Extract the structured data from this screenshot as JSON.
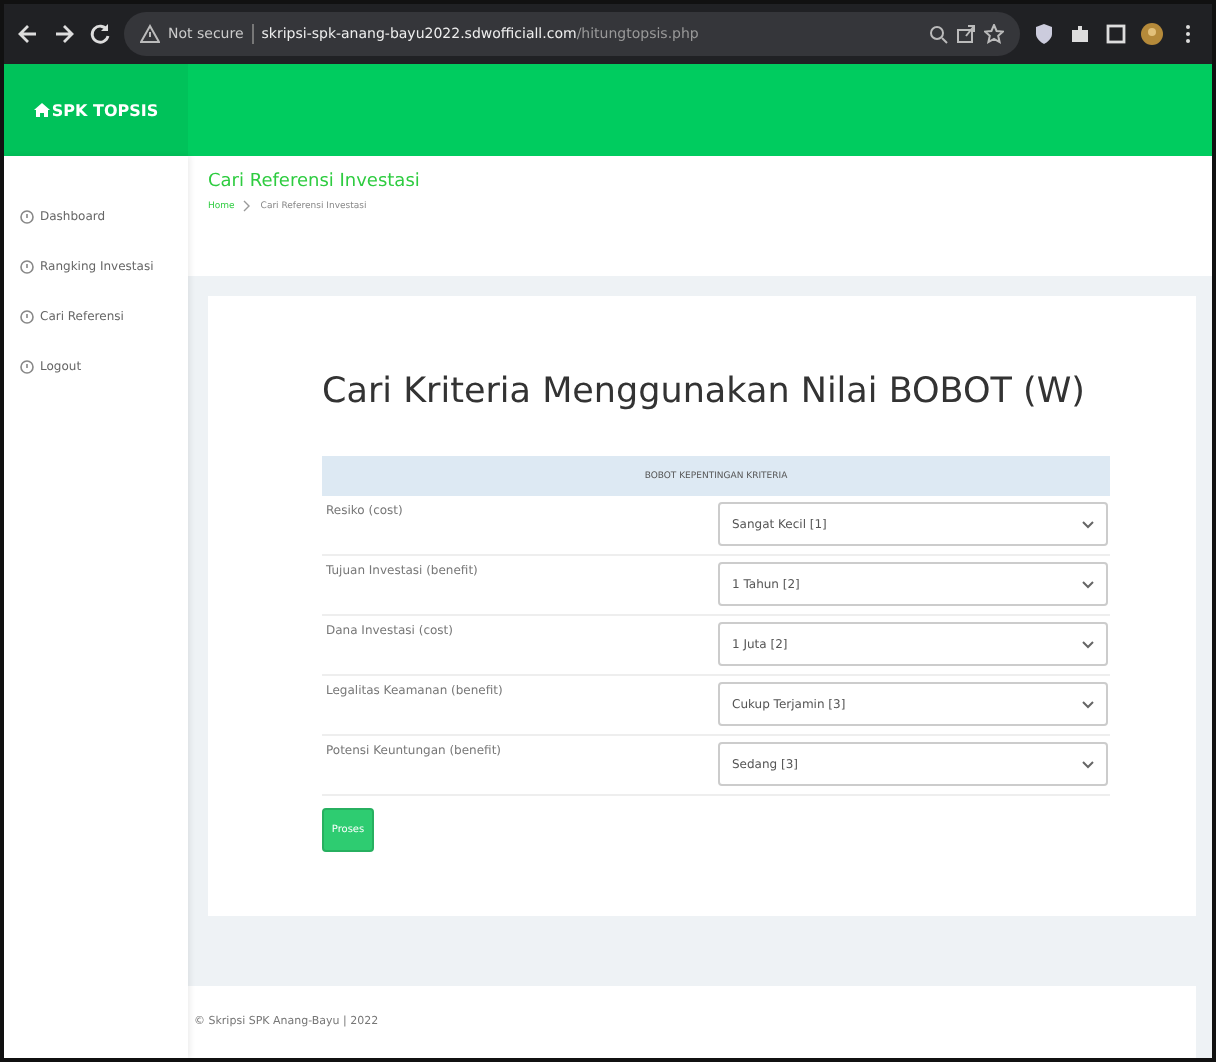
{
  "browser": {
    "security": "Not secure",
    "url_host": "skripsi-spk-anang-bayu2022.sdwofficiall.com",
    "url_path": "/hitungtopsis.php"
  },
  "brand": "SPK TOPSIS",
  "sidebar": {
    "items": [
      {
        "label": "Dashboard",
        "selected": false
      },
      {
        "label": "Rangking Investasi",
        "selected": false
      },
      {
        "label": "Cari Referensi",
        "selected": false
      },
      {
        "label": "Logout",
        "selected": false
      }
    ]
  },
  "page_header": {
    "title": "Cari Referensi Investasi",
    "breadcrumb": [
      "Home",
      "Cari Referensi Investasi"
    ]
  },
  "card": {
    "heading": "Cari Kriteria Menggunakan Nilai BOBOT (W)",
    "table_header": "BOBOT KEPENTINGAN KRITERIA",
    "rows": [
      {
        "label": "Resiko (cost)",
        "value": "Sangat Kecil [1]"
      },
      {
        "label": "Tujuan Investasi (benefit)",
        "value": "1 Tahun [2]"
      },
      {
        "label": "Dana Investasi (cost)",
        "value": "1 Juta [2]"
      },
      {
        "label": "Legalitas Keamanan (benefit)",
        "value": "Cukup Terjamin [3]"
      },
      {
        "label": "Potensi Keuntungan (benefit)",
        "value": "Sedang [3]"
      }
    ],
    "button": "Proses"
  },
  "footer": "© Skripsi SPK Anang-Bayu | 2022"
}
